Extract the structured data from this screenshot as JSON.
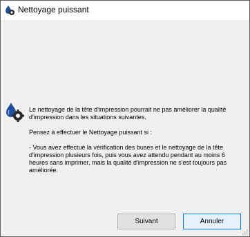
{
  "window": {
    "title": "Nettoyage puissant",
    "title_icon": "printer-head-cleaning-icon"
  },
  "message": {
    "icon": "printer-head-cleaning-icon",
    "paragraph1": "Le nettoyage de la tête d'impression pourrait ne pas améliorer la qualité d'impression dans les situations suivantes.",
    "paragraph2": "Pensez à effectuer le Nettoyage puissant si :",
    "paragraph3": "- Vous avez effectué la vérification des buses et le nettoyage de la tête d'impression plusieurs fois, puis vous avez attendu pendant au moins 6 heures sans imprimer, mais la qualité d'impression ne s'est toujours pas améliorée."
  },
  "buttons": {
    "next_label": "Suivant",
    "cancel_label": "Annuler"
  },
  "colors": {
    "dialog_bg": "#f0f0f0",
    "titlebar_bg": "#ffffff",
    "focus_border": "#0078d7",
    "icon_blue": "#1f4e9e"
  }
}
